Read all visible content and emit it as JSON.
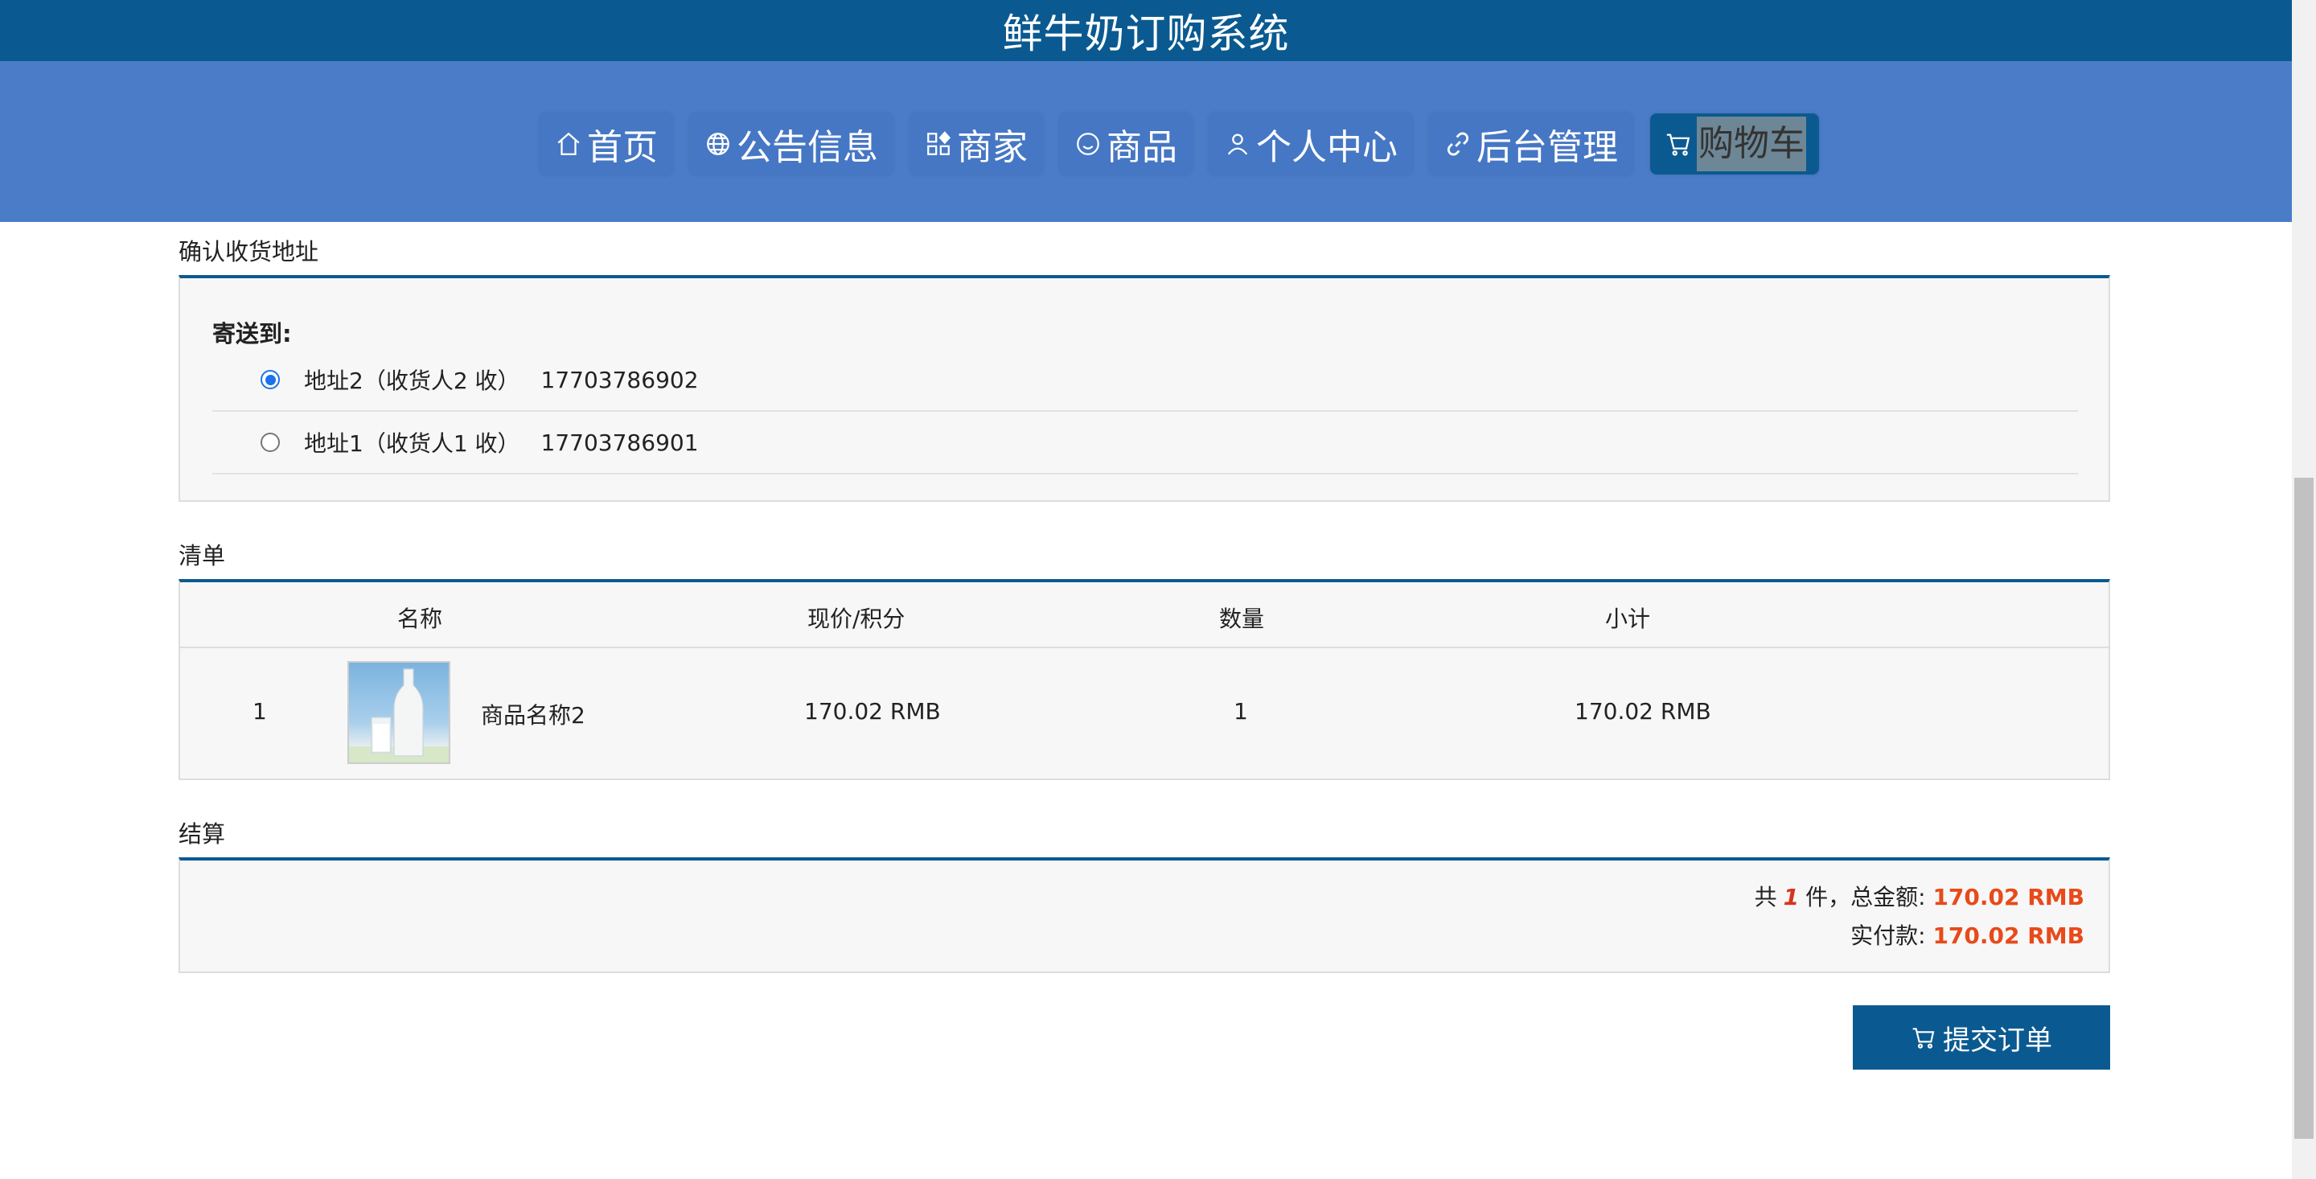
{
  "header": {
    "title": "鲜牛奶订购系统"
  },
  "nav": {
    "items": [
      {
        "label": "首页",
        "icon": "home-icon"
      },
      {
        "label": "公告信息",
        "icon": "globe-icon"
      },
      {
        "label": "商家",
        "icon": "grid-icon"
      },
      {
        "label": "商品",
        "icon": "smile-icon"
      },
      {
        "label": "个人中心",
        "icon": "user-icon"
      },
      {
        "label": "后台管理",
        "icon": "link-icon"
      },
      {
        "label": "购物车",
        "icon": "cart-icon",
        "active": true
      }
    ]
  },
  "address": {
    "section_title": "确认收货地址",
    "label": "寄送到:",
    "options": [
      {
        "name": "地址2",
        "receiver": "（收货人2 收）",
        "phone": "17703786902",
        "selected": true
      },
      {
        "name": "地址1",
        "receiver": "（收货人1 收）",
        "phone": "17703786901",
        "selected": false
      }
    ]
  },
  "list": {
    "section_title": "清单",
    "headers": [
      "名称",
      "现价/积分",
      "数量",
      "小计"
    ],
    "rows": [
      {
        "index": "1",
        "name": "商品名称2",
        "price": "170.02 RMB",
        "qty": "1",
        "subtotal": "170.02 RMB"
      }
    ]
  },
  "settle": {
    "section_title": "结算",
    "prefix": "共",
    "count": "1",
    "middle": "件，总金额:",
    "total": "170.02 RMB",
    "pay_label": "实付款:",
    "pay_amount": "170.02 RMB"
  },
  "submit": {
    "label": "提交订单",
    "icon": "cart-icon"
  },
  "colors": {
    "header": "#0a5a91",
    "nav": "#4a7cc8",
    "accent": "#0a5a91",
    "price": "#e84a1a"
  }
}
